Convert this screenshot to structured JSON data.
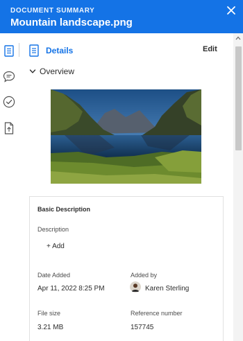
{
  "header": {
    "subtitle": "DOCUMENT SUMMARY",
    "title": "Mountain landscape.png",
    "close_icon": "close-icon",
    "background": "#1473e6"
  },
  "rail": {
    "items": [
      {
        "icon": "document-icon"
      },
      {
        "icon": "comment-icon"
      },
      {
        "icon": "checkmark-circle-icon"
      },
      {
        "icon": "file-share-icon"
      }
    ]
  },
  "tabs": {
    "active_label": "Details",
    "edit_label": "Edit"
  },
  "overview": {
    "label": "Overview",
    "expanded": true
  },
  "details": {
    "heading": "Basic Description",
    "description_label": "Description",
    "add_label": "+ Add",
    "date_added_label": "Date Added",
    "date_added_value": "Apr 11, 2022 8:25 PM",
    "added_by_label": "Added by",
    "added_by_value": "Karen Sterling",
    "file_size_label": "File size",
    "file_size_value": "3.21 MB",
    "reference_label": "Reference number",
    "reference_value": "157745"
  },
  "accent_color": "#1473e6"
}
